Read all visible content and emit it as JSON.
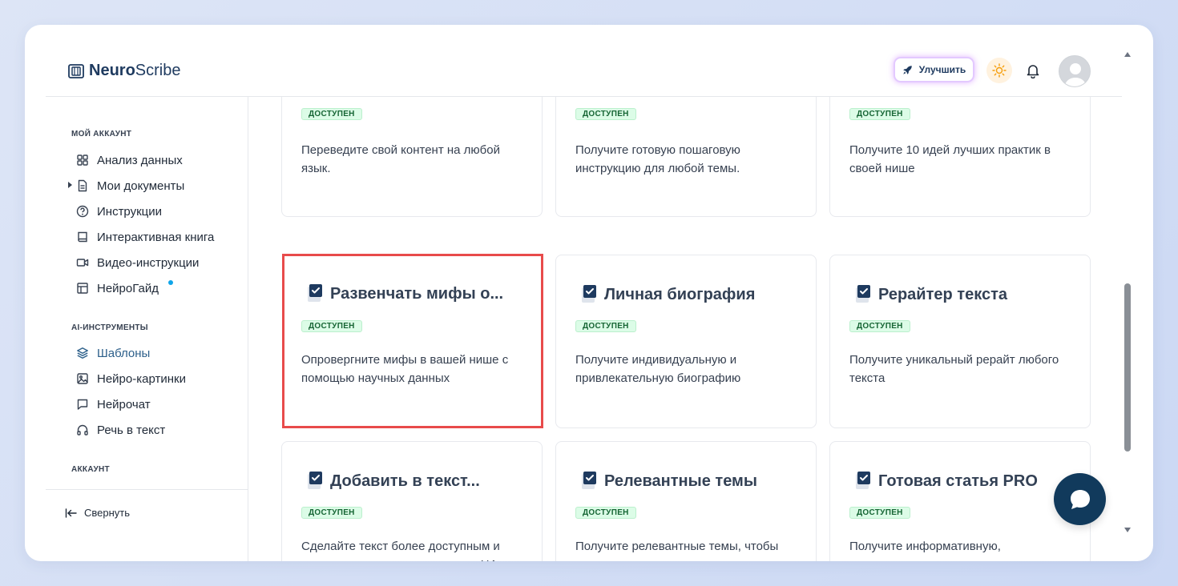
{
  "brand": {
    "name_bold": "Neuro",
    "name_rest": "Scribe"
  },
  "header": {
    "upgrade_label": "Улучшить"
  },
  "sidebar": {
    "sections": [
      {
        "label": "МОЙ АККАУНТ"
      },
      {
        "label": "AI-ИНСТРУМЕНТЫ"
      },
      {
        "label": "АККАУНТ"
      }
    ],
    "items": [
      {
        "label": "Анализ данных",
        "icon": "grid-icon"
      },
      {
        "label": "Мои документы",
        "icon": "document-icon"
      },
      {
        "label": "Инструкции",
        "icon": "help-circle-icon"
      },
      {
        "label": "Интерактивная книга",
        "icon": "book-icon"
      },
      {
        "label": "Видео-инструкции",
        "icon": "video-icon"
      },
      {
        "label": "НейроГайд",
        "icon": "layout-icon"
      },
      {
        "label": "Шаблоны",
        "icon": "layers-icon",
        "active": true
      },
      {
        "label": "Нейро-картинки",
        "icon": "image-icon"
      },
      {
        "label": "Нейрочат",
        "icon": "chat-icon"
      },
      {
        "label": "Речь в текст",
        "icon": "headphones-icon"
      }
    ],
    "collapse_label": "Свернуть"
  },
  "cards": [
    {
      "title": "",
      "badge": "ДОСТУПЕН",
      "desc": "Переведите свой контент на любой язык."
    },
    {
      "title": "",
      "badge": "ДОСТУПЕН",
      "desc": "Получите готовую пошаговую инструкцию для любой темы."
    },
    {
      "title": "",
      "badge": "ДОСТУПЕН",
      "desc": "Получите 10 идей лучших практик в своей нише"
    },
    {
      "title": "Развенчать мифы о...",
      "badge": "ДОСТУПЕН",
      "desc": "Опровергните мифы в вашей нише с помощью научных данных",
      "highlighted": true
    },
    {
      "title": "Личная биография",
      "badge": "ДОСТУПЕН",
      "desc": "Получите индивидуальную и привлекательную биографию"
    },
    {
      "title": "Рерайтер текста",
      "badge": "ДОСТУПЕН",
      "desc": "Получите уникальный рерайт любого текста"
    },
    {
      "title": "Добавить в текст...",
      "badge": "ДОСТУПЕН",
      "desc": "Сделайте текст более доступным и понятным для чтения под вашу ЦА"
    },
    {
      "title": "Релевантные темы",
      "badge": "ДОСТУПЕН",
      "desc": "Получите релевантные темы, чтобы привлечь аудиторию и продвинуть"
    },
    {
      "title": "Готовая статья PRO",
      "badge": "ДОСТУПЕН",
      "desc": "Получите информативную, увлекательную и полезную статью"
    }
  ],
  "colors": {
    "brand": "#1e3a5f",
    "active": "#2c5f8a",
    "badge_bg": "#dcfce7",
    "highlight": "#e84b4b",
    "chat": "#113a5c"
  }
}
